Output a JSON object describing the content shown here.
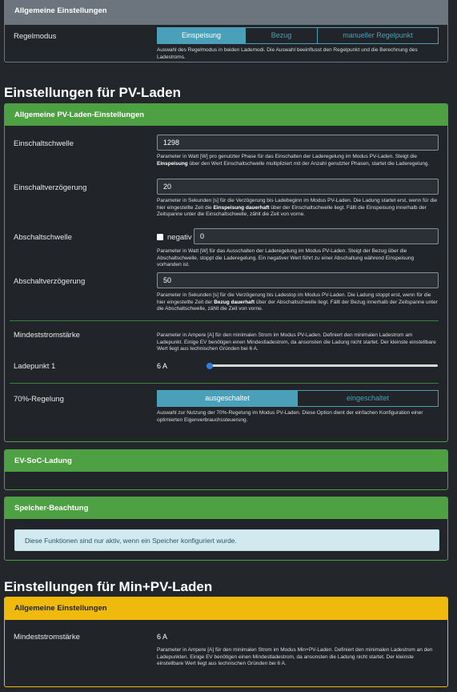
{
  "general": {
    "header": "Allgemeine Einstellungen",
    "regelmodus_label": "Regelmodus",
    "modes": [
      "Einspeisung",
      "Bezug",
      "manueller Regelpunkt"
    ],
    "active_mode": "Einspeisung",
    "regelmodus_help": "Auswahl des Regelmodus in beiden Lademodi. Die Auswahl beeinflusst den Regelpunkt und die Berechnung des Ladestroms."
  },
  "pv": {
    "title": "Einstellungen für PV-Laden",
    "header": "Allgemeine PV-Laden-Einstellungen",
    "einschaltschwelle": {
      "label": "Einschaltschwelle",
      "value": "1298",
      "help_pre": "Parameter in Watt [W] pro genutzter Phase für das Einschalten der Laderegelung im Modus PV-Laden. Steigt die ",
      "help_b": "Einspeisung",
      "help_post": " über den Wert Einschaltschwelle multipliziert mit der Anzahl genutzter Phasen, startet die Laderegelung."
    },
    "einschaltverzoegerung": {
      "label": "Einschaltverzögerung",
      "value": "20",
      "help_pre": "Parameter in Sekunden [s] für die Verzögerung bis Ladebeginn im Modus PV-Laden. Die Ladung startet erst, wenn für die hier eingestellte Zeit die ",
      "help_b": "Einspeisung dauerhaft",
      "help_post": " über der Einschaltschwelle liegt. Fällt die Einspeisung innerhalb der Zeitspanne unter die Einschaltschwelle, zählt die Zeit von vorne."
    },
    "abschaltschwelle": {
      "label": "Abschaltschwelle",
      "checkbox_label": "negativ",
      "value": "0",
      "help": "Parameter in Watt [W] für das Ausschalten der Laderegelung im Modus PV-Laden. Steigt der Bezug über die Abschaltschwelle, stoppt die Laderegelung. Ein negativer Wert führt zu einer Abschaltung während Einspeisung vorhanden ist."
    },
    "abschaltverzoegerung": {
      "label": "Abschaltverzögerung",
      "value": "50",
      "help_pre": "Parameter in Sekunden [s] für die Verzögerung bis Ladestop im Modus PV-Laden. Die Ladung stoppt erst, wenn für die hier eingestellte Zeit der ",
      "help_b": "Bezug dauerhaft",
      "help_post": " über der Abschaltschwelle liegt. Fällt der Bezug innerhalb der Zeitspanne unter die Abschaltschwelle, zählt die Zeit von vorne."
    },
    "mindeststrom": {
      "label": "Mindeststromstärke",
      "help": "Parameter in Ampere [A] für den minimalen Strom im Modus PV-Laden. Definiert den minimalen Ladestrom am Ladepunkt. Einige EV benötigen einen Mindestladestrom, da ansonsten die Ladung nicht startet. Der kleinste einstellbare Wert liegt aus technischen Gründen bei 6 A.",
      "ladepunkt_label": "Ladepunkt 1",
      "ladepunkt_value": "6 A",
      "ladepunkt_fraction": 0.0
    },
    "regelung70": {
      "label": "70%-Regelung",
      "options": [
        "ausgeschaltet",
        "eingeschaltet"
      ],
      "active": "ausgeschaltet",
      "help": "Auswahl zur Nutzung der 70%-Regelung im Modus PV-Laden. Diese Option dient der einfachen Konfiguration einer optimierten Eigenverbrauchssteuerung."
    },
    "evsoc_header": "EV-SoC-Ladung",
    "speicher_header": "Speicher-Beachtung",
    "speicher_alert": "Diese Funktionen sind nur aktiv, wenn ein Speicher konfiguriert wurde."
  },
  "minpv": {
    "title": "Einstellungen für Min+PV-Laden",
    "header": "Allgemeine Einstellungen",
    "mindeststrom_label": "Mindeststromstärke",
    "mindeststrom_value": "6 A",
    "help": "Parameter in Ampere [A] für den minimalen Strom im Modus Min+PV-Laden. Definiert den minimalen Ladestrom an den Ladepunkten. Einige EV benötigen einen Mindestladestrom, da ansonsten die Ladung nicht startet. Der kleinste einstellbare Wert liegt aus technischen Gründen bei 6 A."
  },
  "colors": {
    "gray_header": "#6c757d",
    "green_header": "#4ea143",
    "yellow_header": "#f0ba0d",
    "info_button": "#4aa0b8",
    "slider_thumb": "#2f7de0",
    "alert_bg": "#d2e9f0"
  }
}
